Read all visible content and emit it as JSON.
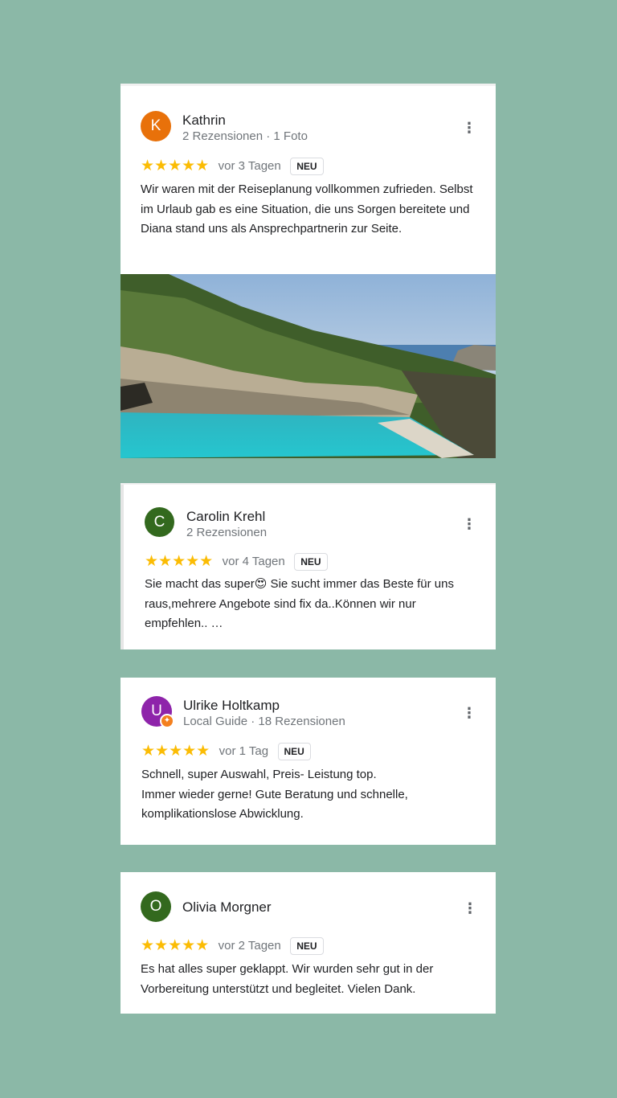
{
  "reviews": [
    {
      "avatar_letter": "K",
      "avatar_color": "#e8710a",
      "name": "Kathrin",
      "meta": "2 Rezensionen · 1 Foto",
      "stars": "★★★★★",
      "rating": 5,
      "date": "vor 3 Tagen",
      "badge": "NEU",
      "text": "Wir waren mit der Reiseplanung vollkommen zufrieden. Selbst im Urlaub gab es eine Situation, die uns Sorgen bereitete und Diana stand uns als Ansprechpartnerin zur Seite.",
      "more_icon": "more-vert-icon"
    },
    {
      "avatar_letter": "C",
      "avatar_color": "#33691e",
      "name": "Carolin Krehl",
      "meta": "2 Rezensionen",
      "stars": "★★★★★",
      "rating": 5,
      "date": "vor 4 Tagen",
      "badge": "NEU",
      "text_before": "Sie macht das super",
      "emoji": "😍",
      "text_after": " Sie sucht immer das Beste für uns raus,mehrere Angebote sind fix da..Können wir nur empfehlen.. …",
      "more_icon": "more-vert-icon"
    },
    {
      "avatar_letter": "U",
      "avatar_color": "#8e24aa",
      "guide_badge": "local-guide-badge-icon",
      "name": "Ulrike Holtkamp",
      "meta": "Local Guide · 18 Rezensionen",
      "stars": "★★★★★",
      "rating": 5,
      "date": "vor 1 Tag",
      "badge": "NEU",
      "text_line1": "Schnell, super Auswahl, Preis- Leistung top.",
      "text_line2": "Immer wieder gerne! Gute Beratung und schnelle, komplikationslose Abwicklung.",
      "more_icon": "more-vert-icon"
    },
    {
      "avatar_letter": "O",
      "avatar_color": "#33691e",
      "name": "Olivia Morgner",
      "stars": "★★★★★",
      "rating": 5,
      "date": "vor 2 Tagen",
      "badge": "NEU",
      "text": "Es hat alles super geklappt. Wir wurden sehr gut in der Vorbereitung unterstützt und begleitet. Vielen Dank.",
      "more_icon": "more-vert-icon"
    }
  ],
  "colors": {
    "background": "#8bb8a7",
    "star": "#fbbc04"
  }
}
